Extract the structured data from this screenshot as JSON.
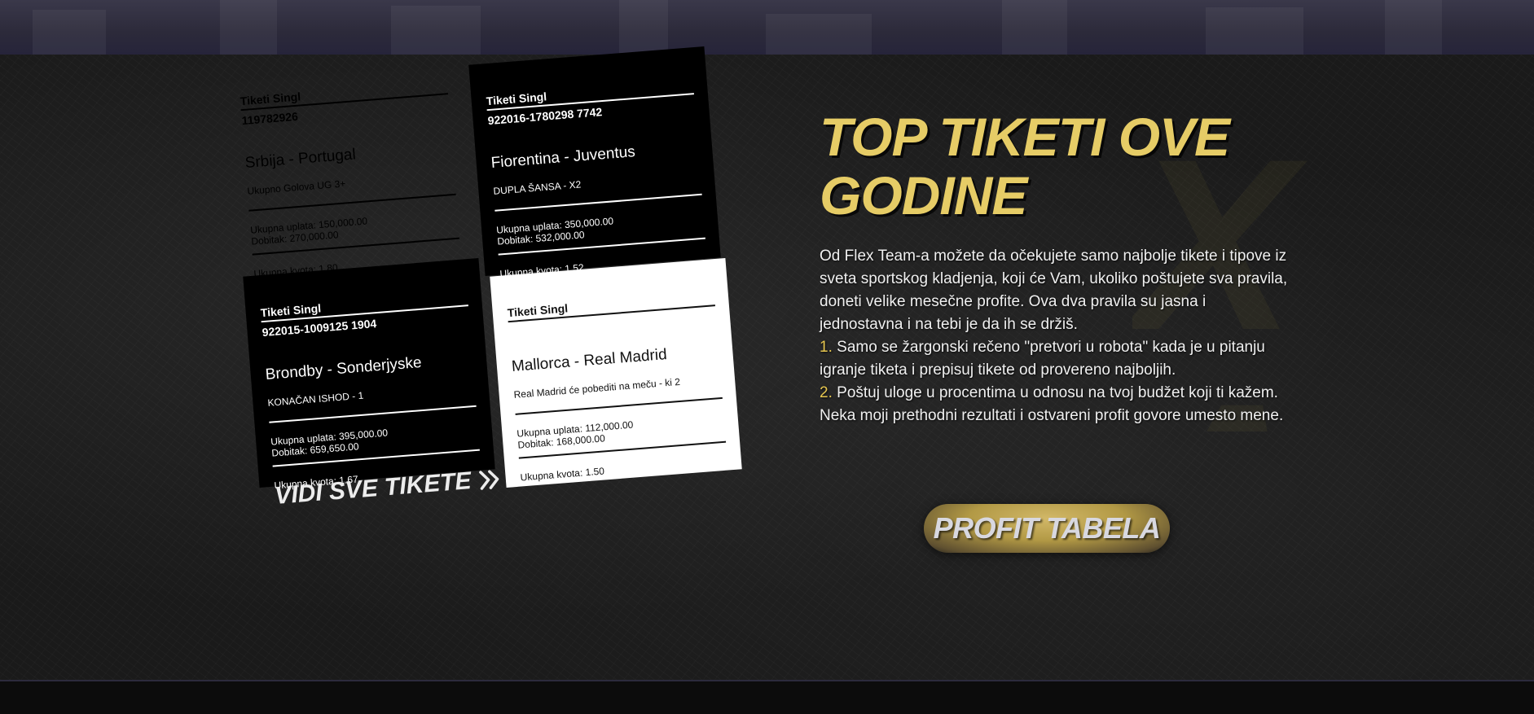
{
  "tickets": [
    {
      "header": "Tiketi Singl",
      "number": "119782926",
      "match": "Srbija - Portugal",
      "market": "Ukupno Golova UG 3+",
      "stake": "Ukupna uplata: 150,000.00",
      "win": "Dobitak: 270,000.00",
      "odds": "Ukupna kvota: 1.80",
      "theme": "white"
    },
    {
      "header": "Tiketi Singl",
      "number": "922016-1780298 7742",
      "match": "Fiorentina - Juventus",
      "market": "DUPLA ŠANSA - X2",
      "stake": "Ukupna uplata: 350,000.00",
      "win": "Dobitak: 532,000.00",
      "odds": "Ukupna kvota: 1.52",
      "theme": "black"
    },
    {
      "header": "Tiketi Singl",
      "number": "922015-1009125 1904",
      "match": "Brondby - Sonderjyske",
      "market": "KONAČAN ISHOD - 1",
      "stake": "Ukupna uplata: 395,000.00",
      "win": "Dobitak: 659,650.00",
      "odds": "Ukupna kvota: 1.67",
      "theme": "black"
    },
    {
      "header": "Tiketi Singl",
      "number": "",
      "match": "Mallorca - Real Madrid",
      "market": "Real Madrid će pobediti na meču - ki 2",
      "stake": "Ukupna uplata: 112,000.00",
      "win": "Dobitak: 168,000.00",
      "odds": "Ukupna kvota: 1.50",
      "theme": "white"
    }
  ],
  "see_all": {
    "label": "VIDI SVE TIKETE",
    "icon": "double-chevron-right-icon"
  },
  "section": {
    "title": "TOP TIKETI OVE GODINE",
    "intro": "Od Flex Team-a možete da očekujete samo najbolje tikete i tipove iz sveta sportskog kladjenja, koji će Vam, ukoliko poštujete sva pravila, doneti velike mesečne profite. Ova dva pravila su jasna i jednostavna i na tebi je da ih se držiš.",
    "rules": [
      {
        "num": "1.",
        "text": "Samo se žargonski rečeno \"pretvori u robota\" kada je u pitanju igranje tiketa i prepisuj tikete od provereno najboljih."
      },
      {
        "num": "2.",
        "text": "Poštuj uloge u procentima u odnosu na tvoj budžet koji ti kažem."
      }
    ],
    "outro": "Neka moji prethodni rezultati i ostvareni profit govore umesto mene."
  },
  "profit_button": {
    "label": "PROFIT TABELA"
  },
  "colors": {
    "accent": "#e6cc66",
    "rule_number": "#e6c64f",
    "background": "#1a1a1a"
  }
}
